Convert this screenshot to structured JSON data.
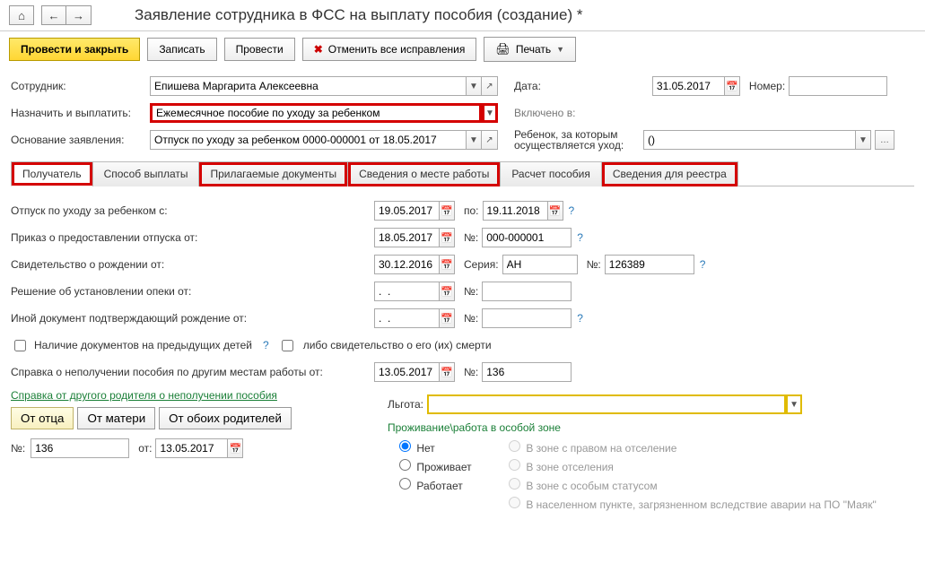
{
  "title": "Заявление сотрудника в ФСС на выплату пособия (создание) *",
  "toolbar": {
    "save_close": "Провести и закрыть",
    "save": "Записать",
    "post": "Провести",
    "cancel_fix": "Отменить все исправления",
    "print": "Печать"
  },
  "header": {
    "employee_label": "Сотрудник:",
    "employee_value": "Епишева Маргарита Алексеевна",
    "date_label": "Дата:",
    "date_value": "31.05.2017",
    "number_label": "Номер:",
    "number_value": "",
    "assign_label": "Назначить и выплатить:",
    "assign_value": "Ежемесячное пособие по уходу за ребенком",
    "included_label": "Включено в:",
    "included_value": "",
    "basis_label": "Основание заявления:",
    "basis_value": "Отпуск по уходу за ребенком 0000-000001 от 18.05.2017",
    "child_label": "Ребенок, за которым осуществляется уход:",
    "child_value": "()"
  },
  "tabs": {
    "t1": "Получатель",
    "t2": "Способ выплаты",
    "t3": "Прилагаемые документы",
    "t4": "Сведения о месте работы",
    "t5": "Расчет пособия",
    "t6": "Сведения для реестра"
  },
  "details": {
    "leave_from_label": "Отпуск по уходу за ребенком с:",
    "leave_from": "19.05.2017",
    "to_label": "по:",
    "leave_to": "19.11.2018",
    "order_label": "Приказ о предоставлении отпуска от:",
    "order_date": "18.05.2017",
    "num_label": "№:",
    "order_num": "000-000001",
    "birth_cert_label": "Свидетельство о рождении от:",
    "birth_cert_date": "30.12.2016",
    "series_label": "Серия:",
    "series": "АН",
    "cert_num": "126389",
    "guardianship_label": "Решение об установлении опеки от:",
    "guardianship_date": ".  .",
    "other_doc_label": "Иной документ подтверждающий рождение от:",
    "other_doc_date": ".  .",
    "prev_docs_label": "Наличие документов на предыдущих детей",
    "or_death_label": "либо свидетельство о его (их) смерти",
    "nonreceipt_label": "Справка о неполучении пособия по другим местам работы от:",
    "nonreceipt_date": "13.05.2017",
    "nonreceipt_num": "136",
    "other_parent_link": "Справка от другого родителя о неполучении пособия",
    "from_father": "От отца",
    "from_mother": "От матери",
    "from_both": "От обоих родителей",
    "ref_num_label": "№:",
    "ref_num": "136",
    "ref_from_label": "от:",
    "ref_from": "13.05.2017",
    "benefit_label": "Льгота:",
    "benefit_value": "",
    "zone_title": "Проживание\\работа в особой зоне",
    "zone_no": "Нет",
    "zone_right": "В зоне с правом на отселение",
    "zone_live": "Проживает",
    "zone_resettle": "В зоне отселения",
    "zone_work": "Работает",
    "zone_special": "В зоне с особым статусом",
    "zone_chaes": "В населенном пункте, загрязненном вследствие аварии на ПО \"Маяк\""
  }
}
